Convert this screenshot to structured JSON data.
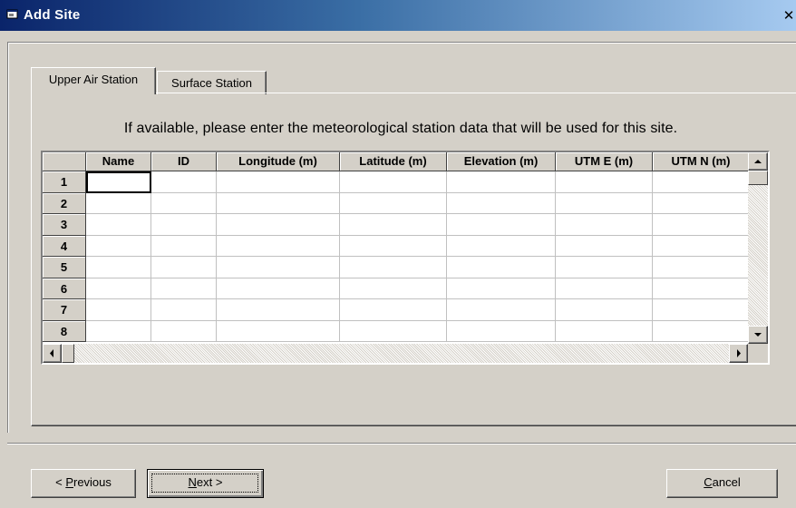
{
  "window": {
    "title": "Add Site",
    "close_glyph": "✕"
  },
  "tabs": [
    {
      "label": "Upper Air Station",
      "active": true
    },
    {
      "label": "Surface Station",
      "active": false
    }
  ],
  "instructions": "If available, please enter the meteorological station data that will be used for this site.",
  "grid": {
    "columns": [
      "Name",
      "ID",
      "Longitude (m)",
      "Latitude (m)",
      "Elevation (m)",
      "UTM E (m)",
      "UTM N (m)"
    ],
    "row_labels": [
      "1",
      "2",
      "3",
      "4",
      "5",
      "6",
      "7",
      "8"
    ],
    "focused_cell": {
      "row": 1,
      "column": "Name"
    }
  },
  "buttons": {
    "previous": {
      "prefix": "< ",
      "mnemonic": "P",
      "rest": "revious"
    },
    "next": {
      "mnemonic": "N",
      "rest": "ext >"
    },
    "cancel": {
      "mnemonic": "C",
      "rest": "ancel"
    }
  },
  "icons": {
    "window": "window-icon",
    "scroll_up": "scroll-up-arrow-icon",
    "scroll_down": "scroll-down-arrow-icon",
    "scroll_left": "scroll-left-arrow-icon",
    "scroll_right": "scroll-right-arrow-icon"
  }
}
